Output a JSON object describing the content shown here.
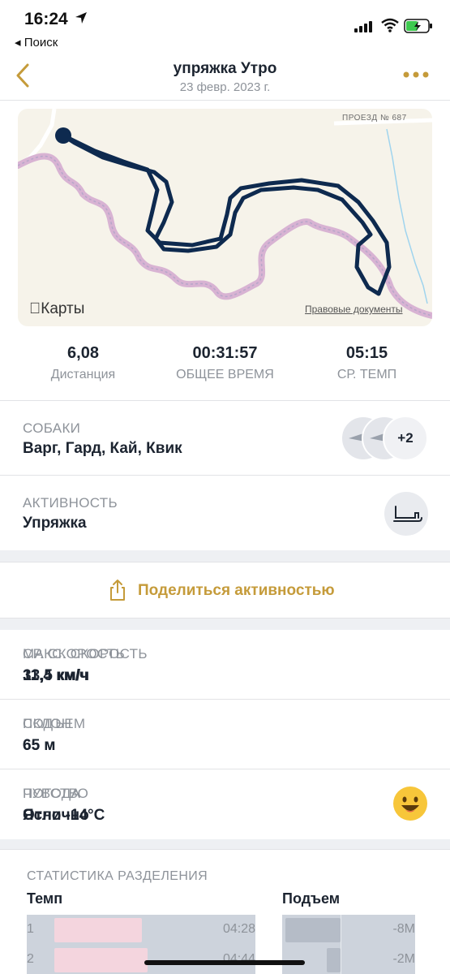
{
  "status_bar": {
    "time": "16:24",
    "back_app": "◂ Поиск"
  },
  "header": {
    "title": "упряжка Утро",
    "subtitle": "23 февр. 2023 г."
  },
  "map": {
    "road_label": "ПРОЕЗД № 687",
    "maps_logo": "Карты",
    "legal": "Правовые документы"
  },
  "summary": [
    {
      "value": "6,08",
      "label": "Дистанция"
    },
    {
      "value": "00:31:57",
      "label": "ОБЩЕЕ ВРЕМЯ"
    },
    {
      "value": "05:15",
      "label": "СР. ТЕМП"
    }
  ],
  "dogs": {
    "label": "СОБАКИ",
    "value": "Варг, Гард, Кай, Квик",
    "extra_count": "+2"
  },
  "activity": {
    "label": "АКТИВНОСТЬ",
    "value": "Упряжка"
  },
  "share": {
    "label": "Поделиться активностью"
  },
  "stats": {
    "avg_speed": {
      "label": "СР. СКОРОСТЬ",
      "value": "11,4 км/ч"
    },
    "max_speed": {
      "label": "МАКС. СКОРОСТЬ",
      "value": "33,5 км/ч"
    },
    "ascent": {
      "label": "ПОДЪЕМ",
      "value": "65 м"
    },
    "descent": {
      "label": "СКЛОН",
      "value": "65 м"
    },
    "weather": {
      "label": "ПОГОДА",
      "value": "Ясно -14°C"
    },
    "feeling": {
      "label": "ЧУВСТВО",
      "value": "Отлично"
    }
  },
  "splits": {
    "header": "СТАТИСТИКА РАЗДЕЛЕНИЯ",
    "pace_header": "Темп",
    "elev_header": "Подъем",
    "rows": [
      {
        "n": "1",
        "pace": "04:28",
        "pace_fraction": 0.45,
        "elev": "-8M",
        "elev_value": -8
      },
      {
        "n": "2",
        "pace": "04:44",
        "pace_fraction": 0.48,
        "elev": "-2M",
        "elev_value": -2
      }
    ]
  },
  "colors": {
    "accent": "#c59b3a",
    "route": "#0e2a4f",
    "muted": "#8e939a"
  }
}
